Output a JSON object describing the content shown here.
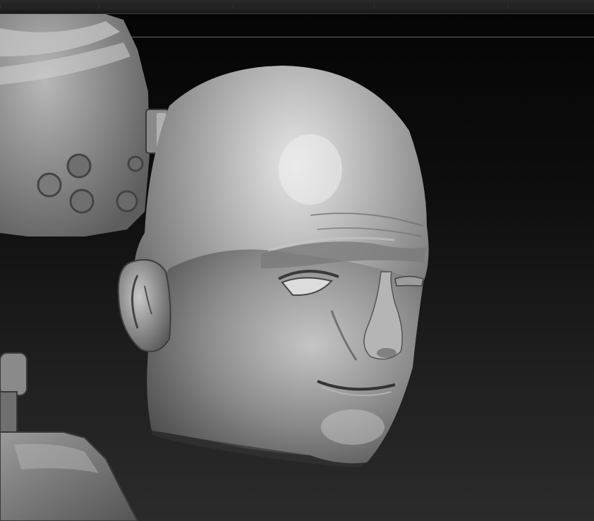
{
  "app": {
    "topbar_icon": "toolbar-strip",
    "viewport_icon": "3d-sculpt-viewport"
  },
  "scene": {
    "objects": [
      {
        "name": "sculpted-bald-head",
        "icon": "head-icon"
      },
      {
        "name": "helmet-fragment",
        "icon": "helmet-icon"
      },
      {
        "name": "shoulder-armor-fragment",
        "icon": "armor-icon"
      }
    ],
    "colors": {
      "background_top": "#050505",
      "background_bottom": "#2b2b2b",
      "clay_light": "#d8d8d8",
      "clay_mid": "#9a9a9a",
      "clay_dark": "#4a4a4a"
    }
  }
}
